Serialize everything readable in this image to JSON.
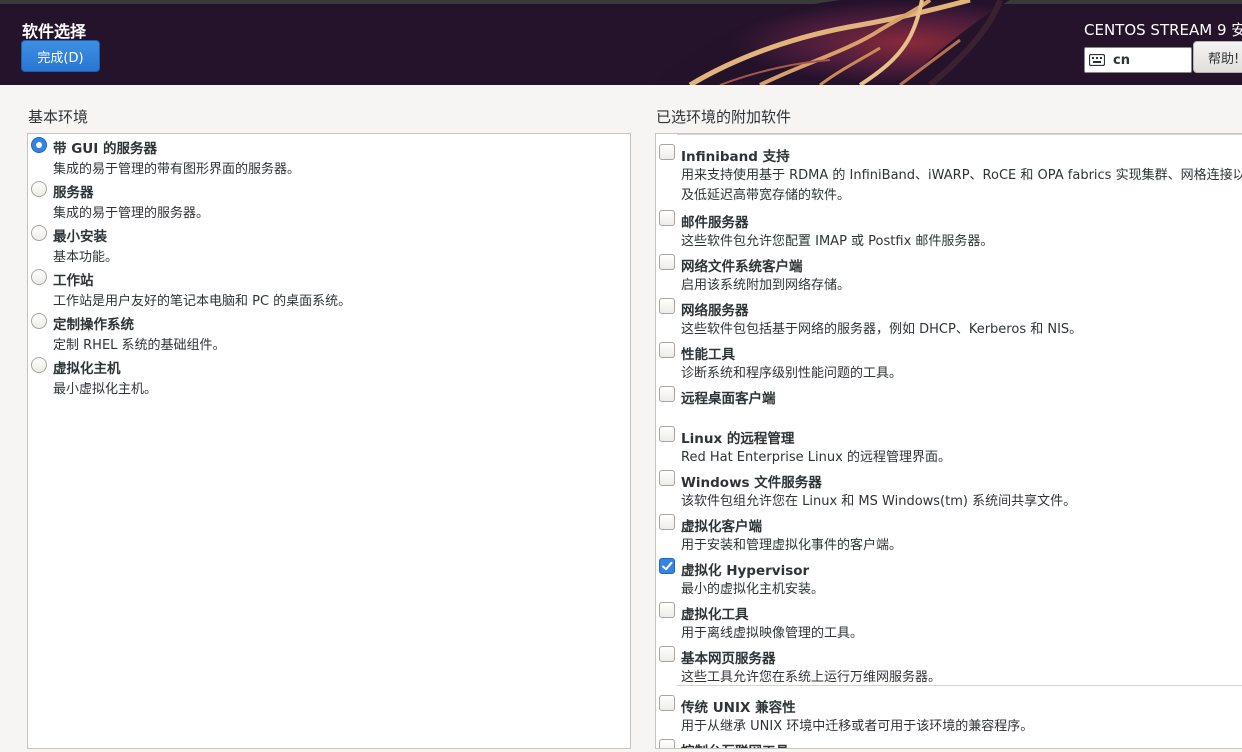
{
  "header": {
    "title": "软件选择",
    "done_button": "完成(D)",
    "product_name": "CENTOS STREAM 9 安",
    "keyboard_layout": "cn",
    "help_button": "帮助!"
  },
  "base_environment": {
    "heading": "基本环境",
    "items": [
      {
        "title": "带 GUI 的服务器",
        "desc": "集成的易于管理的带有图形界面的服务器。",
        "selected": true
      },
      {
        "title": "服务器",
        "desc": "集成的易于管理的服务器。",
        "selected": false
      },
      {
        "title": "最小安装",
        "desc": "基本功能。",
        "selected": false
      },
      {
        "title": "工作站",
        "desc": "工作站是用户友好的笔记本电脑和 PC 的桌面系统。",
        "selected": false
      },
      {
        "title": "定制操作系统",
        "desc": "定制 RHEL 系统的基础组件。",
        "selected": false
      },
      {
        "title": "虚拟化主机",
        "desc": "最小虚拟化主机。",
        "selected": false
      }
    ]
  },
  "addons": {
    "heading": "已选环境的附加软件",
    "items": [
      {
        "title": "Infiniband 支持",
        "desc": "用来支持使用基于 RDMA 的 InfiniBand、iWARP、RoCE 和 OPA fabrics 实现集群、网格连接以及低延迟高带宽存储的软件。",
        "checked": false
      },
      {
        "title": "邮件服务器",
        "desc": "这些软件包允许您配置 IMAP 或 Postfix 邮件服务器。",
        "checked": false
      },
      {
        "title": "网络文件系统客户端",
        "desc": "启用该系统附加到网络存储。",
        "checked": false
      },
      {
        "title": "网络服务器",
        "desc": "这些软件包包括基于网络的服务器，例如 DHCP、Kerberos 和 NIS。",
        "checked": false
      },
      {
        "title": "性能工具",
        "desc": "诊断系统和程序级别性能问题的工具。",
        "checked": false
      },
      {
        "title": "远程桌面客户端",
        "desc": "",
        "checked": false
      },
      {
        "title": "Linux 的远程管理",
        "desc": "Red Hat Enterprise Linux 的远程管理界面。",
        "checked": false
      },
      {
        "title": "Windows 文件服务器",
        "desc": "该软件包组允许您在 Linux 和 MS Windows(tm) 系统间共享文件。",
        "checked": false
      },
      {
        "title": "虚拟化客户端",
        "desc": "用于安装和管理虚拟化事件的客户端。",
        "checked": false
      },
      {
        "title": "虚拟化 Hypervisor",
        "desc": "最小的虚拟化主机安装。",
        "checked": true
      },
      {
        "title": "虚拟化工具",
        "desc": "用于离线虚拟映像管理的工具。",
        "checked": false
      },
      {
        "title": "基本网页服务器",
        "desc": "这些工具允许您在系统上运行万维网服务器。",
        "checked": false
      },
      {
        "title": "传统 UNIX 兼容性",
        "desc": "用于从继承 UNIX 环境中迁移或者可用于该环境的兼容程序。",
        "checked": false
      },
      {
        "title": "控制台互联网工具",
        "desc": "",
        "checked": false
      }
    ]
  },
  "colors": {
    "accent": "#3584e4",
    "header_bg": "#2b1526"
  }
}
